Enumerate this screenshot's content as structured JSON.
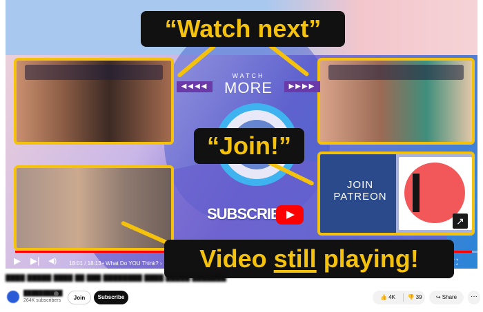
{
  "overlay": {
    "watch_next": "“Watch next”",
    "join": "“Join!”",
    "video_still_pre": "Video ",
    "video_still_under": "still",
    "video_still_post": " playing!"
  },
  "endscreen": {
    "watch_small": "WATCH",
    "watch_more": "MORE",
    "arrows_left": "◀◀◀◀",
    "arrows_right": "▶▶▶▶",
    "subscribe_label": "SUBSCRIBE",
    "join_patreon": "JOIN PATREON"
  },
  "player": {
    "progress": 0.985,
    "time": "18:01 / 18:13",
    "chapter": "• What Do YOU Think? ›"
  },
  "video": {
    "subscribers": "264K subscribers",
    "join_label": "Join",
    "subscribe_label": "Subscribe",
    "likes": "4K",
    "dislikes": "39",
    "share_label": "Share",
    "more_label": "···"
  }
}
